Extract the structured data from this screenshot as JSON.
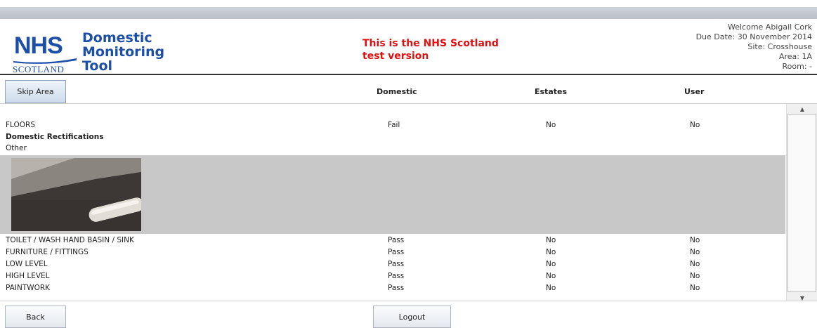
{
  "header": {
    "logo_nhs": "NHS",
    "logo_scotland": "SCOTLAND",
    "app_name": [
      "Domestic",
      "Monitoring",
      "Tool"
    ],
    "test_message": [
      "This is the NHS Scotland",
      "test version"
    ],
    "user_info": {
      "welcome": "Welcome Abigail Cork",
      "due_date": "Due Date: 30 November 2014",
      "site": "Site: Crosshouse",
      "area": "Area: 1A",
      "room": "Room: -"
    }
  },
  "columns": {
    "skip_area_label": "Skip Area",
    "domestic": "Domestic",
    "estates": "Estates",
    "user": "User"
  },
  "items_top": [
    {
      "name": "FLOORS",
      "domestic": "Fail",
      "estates": "No",
      "user": "No"
    }
  ],
  "rectification": {
    "heading": "Domestic Rectifications",
    "type": "Other"
  },
  "items": [
    {
      "name": "TOILET / WASH HAND BASIN / SINK",
      "domestic": "Pass",
      "estates": "No",
      "user": "No"
    },
    {
      "name": "FURNITURE / FITTINGS",
      "domestic": "Pass",
      "estates": "No",
      "user": "No"
    },
    {
      "name": "LOW LEVEL",
      "domestic": "Pass",
      "estates": "No",
      "user": "No"
    },
    {
      "name": "HIGH LEVEL",
      "domestic": "Pass",
      "estates": "No",
      "user": "No"
    },
    {
      "name": "PAINTWORK",
      "domestic": "Pass",
      "estates": "No",
      "user": "No"
    }
  ],
  "footer": {
    "back_label": "Back",
    "logout_label": "Logout"
  },
  "colors": {
    "nhs_blue": "#1c4fa8",
    "test_red": "#e01010"
  }
}
